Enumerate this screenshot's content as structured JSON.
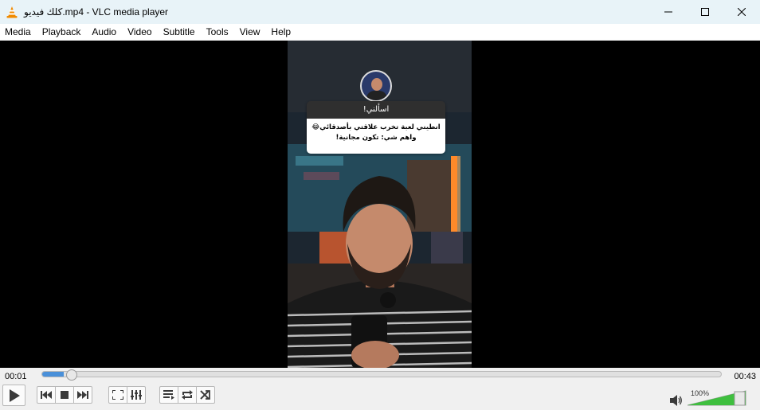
{
  "window": {
    "title": "كلك فيديو.mp4 - VLC media player",
    "icon": "vlc-cone-icon",
    "buttons": [
      "minimize-icon",
      "maximize-icon",
      "close-icon"
    ]
  },
  "menu": [
    "Media",
    "Playback",
    "Audio",
    "Video",
    "Subtitle",
    "Tools",
    "View",
    "Help"
  ],
  "video": {
    "caption_title": "اسألني!",
    "caption_line1": "انطيني لعبة تخرب علاقتي بأصدقائي😂",
    "caption_line2": "واهم شي: تكون مجانية!"
  },
  "playback": {
    "elapsed": "00:01",
    "duration": "00:43",
    "progress_fraction": 0.025
  },
  "volume": {
    "label": "100%",
    "level_fraction": 1.0
  },
  "colors": {
    "titlebar": "#e8f3f8",
    "seek_fill": "#4a90d9",
    "volume_fill": "#3fbf3f"
  }
}
